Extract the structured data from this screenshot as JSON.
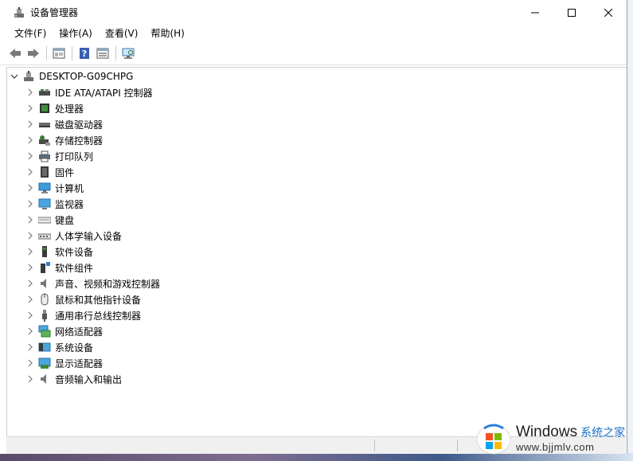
{
  "window": {
    "title": "设备管理器"
  },
  "menu": [
    {
      "label": "文件(F)"
    },
    {
      "label": "操作(A)"
    },
    {
      "label": "查看(V)"
    },
    {
      "label": "帮助(H)"
    }
  ],
  "toolbar": {
    "buttons": [
      "back-arrow-icon",
      "forward-arrow-icon",
      "show-hide-tree-icon",
      "help-icon",
      "properties-icon",
      "scan-hardware-icon"
    ]
  },
  "tree": {
    "root": "DESKTOP-G09CHPG",
    "items": [
      {
        "label": "IDE ATA/ATAPI 控制器",
        "icon": "ide-controller-icon"
      },
      {
        "label": "处理器",
        "icon": "processor-icon"
      },
      {
        "label": "磁盘驱动器",
        "icon": "disk-drive-icon"
      },
      {
        "label": "存储控制器",
        "icon": "storage-controller-icon"
      },
      {
        "label": "打印队列",
        "icon": "printer-icon"
      },
      {
        "label": "固件",
        "icon": "firmware-icon"
      },
      {
        "label": "计算机",
        "icon": "computer-icon"
      },
      {
        "label": "监视器",
        "icon": "monitor-icon"
      },
      {
        "label": "键盘",
        "icon": "keyboard-icon"
      },
      {
        "label": "人体学输入设备",
        "icon": "hid-icon"
      },
      {
        "label": "软件设备",
        "icon": "software-device-icon"
      },
      {
        "label": "软件组件",
        "icon": "software-component-icon"
      },
      {
        "label": "声音、视频和游戏控制器",
        "icon": "speaker-icon"
      },
      {
        "label": "鼠标和其他指针设备",
        "icon": "mouse-icon"
      },
      {
        "label": "通用串行总线控制器",
        "icon": "usb-icon"
      },
      {
        "label": "网络适配器",
        "icon": "network-adapter-icon"
      },
      {
        "label": "系统设备",
        "icon": "system-device-icon"
      },
      {
        "label": "显示适配器",
        "icon": "display-adapter-icon"
      },
      {
        "label": "音频输入和输出",
        "icon": "audio-io-icon"
      }
    ]
  },
  "watermark": {
    "brand": "Windows",
    "cn": "系统之家",
    "url": "www.bjjmlv.com"
  }
}
